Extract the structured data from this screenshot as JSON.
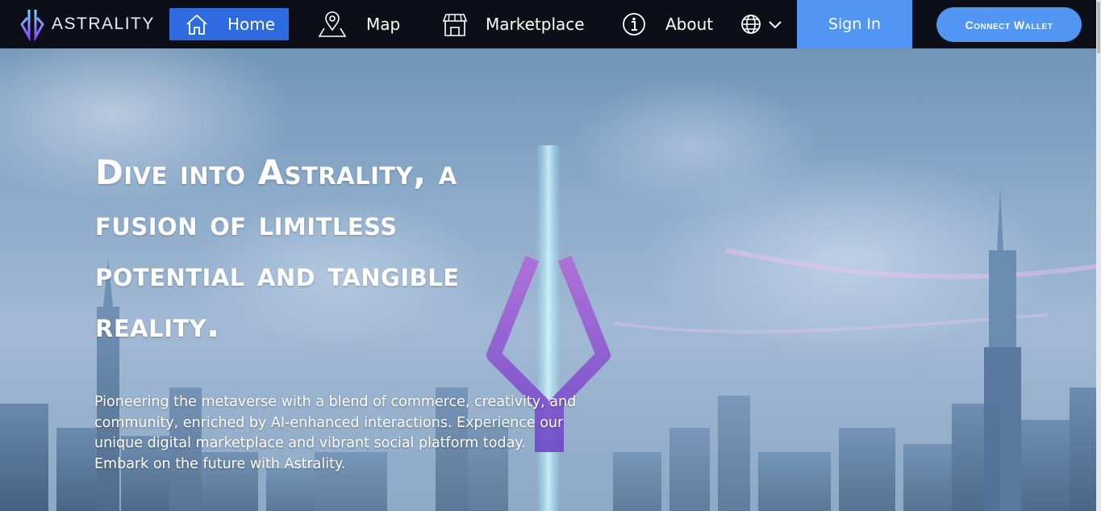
{
  "brand": {
    "name": "ASTRALITY"
  },
  "nav": {
    "items": [
      {
        "label": "Home",
        "icon": "home-icon",
        "active": true
      },
      {
        "label": "Map",
        "icon": "map-pin-icon"
      },
      {
        "label": "Marketplace",
        "icon": "storefront-icon"
      },
      {
        "label": "About",
        "icon": "info-icon"
      }
    ],
    "language_icon": "globe-icon",
    "sign_in": "Sign In",
    "connect_wallet": "Connect Wallet"
  },
  "hero": {
    "headline": "Dive into Astrality, a fusion of limitless potential and tangible reality.",
    "subtext": "Pioneering the metaverse with a blend of commerce, creativity, and community, enriched by AI-enhanced interactions. Experience our unique digital marketplace and vibrant social platform today. Embark on the future with Astrality."
  },
  "colors": {
    "nav_bg": "#0c0f17",
    "accent": "#5096f2",
    "active_nav": "#2f6be0"
  }
}
